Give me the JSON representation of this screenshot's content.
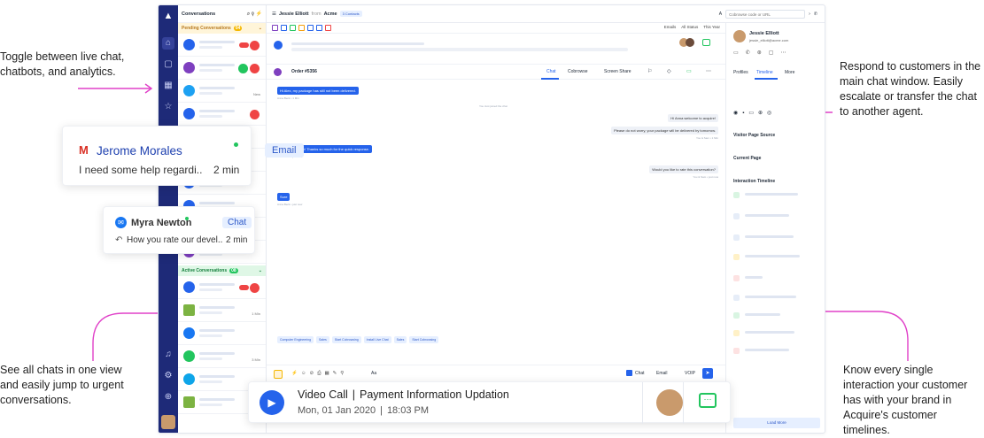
{
  "callouts": {
    "left_top": "Toggle between live chat, chatbots, and analytics.",
    "left_bottom": "See all chats in one view and easily jump to urgent conversations.",
    "right_top": "Respond to customers in the main chat window. Easily escalate or transfer the chat to another agent.",
    "right_bottom": "Know every single interaction your customer has with your brand in Acquire's customer timelines."
  },
  "sidebar": {
    "title": "Conversations",
    "pending_label": "Pending Conversations",
    "pending_count": "04",
    "active_label": "Active Conversations",
    "active_count": "08",
    "timestamps": {
      "new": "New",
      "min1": "1 Min",
      "min3": "3 Min",
      "min2": "2 Min",
      "min2b": "2 min"
    }
  },
  "header": {
    "user": "Jessie Elliott",
    "from": "from",
    "company": "Acme",
    "contacts": "3 Contacts",
    "cobrowse_placeholder": "Cobrowse code or URL"
  },
  "filters": {
    "emails": "Emails",
    "status": "All Status",
    "period": "This Year"
  },
  "chat": {
    "order": "Order #5356",
    "tabs": {
      "chat": "Chat",
      "cobrowse": "Cobrowse",
      "screen": "Screen Share"
    },
    "messages": {
      "m1": "Hi Alex, my package has still not been delivered.",
      "m1_meta": "Anna Beck  •  1 Min",
      "joined": "You Just joined the chat",
      "m2": "Hi Anna welcome to acquire!",
      "m3": "Please do not worry, your package will be delivered by tomorrow.",
      "m3_meta": "You & Sam  •  1 Min",
      "m4": "Wow, awesome! Thanks so much for the quick response.",
      "m4_meta": "Anna Beck  •  just now",
      "m5": "Would you like to rate this conversation?",
      "m5_meta": "You & Sam  •  just now",
      "m6": "Sure",
      "m6_meta": "Anna Beck  •  just now"
    },
    "tags": [
      "Computer Engineering",
      "Sales",
      "Start Cobrowsing",
      "Install Live Chat",
      "Sales",
      "Start Cobrowsing"
    ],
    "compose": {
      "chat": "Chat",
      "email": "Email",
      "voip": "VOIP",
      "aa": "Aa"
    }
  },
  "profile": {
    "name": "Jessie Elliott",
    "email": "jessie_elliott@acme.com",
    "tabs": {
      "profiles": "Profiles",
      "timeline": "Timeline",
      "more": "More"
    },
    "visitor_source": "Visitor Page Source",
    "current_page": "Current Page",
    "interaction_timeline": "Interaction Timeline",
    "load_more": "Load More"
  },
  "cards": {
    "jerome": {
      "name": "Jerome Morales",
      "channel": "Email",
      "preview": "I need some help regardi...",
      "time": "2 min"
    },
    "myra": {
      "name": "Myra Newton",
      "channel": "Chat",
      "preview": "How you rate our devel...",
      "time": "2 min"
    },
    "video": {
      "title": "Video Call",
      "sep": "|",
      "subject": "Payment Information Updation",
      "date": "Mon, 01 Jan 2020",
      "time": "18:03 PM"
    }
  },
  "colors": {
    "navy": "#1e2a78",
    "blue": "#2563eb",
    "magenta": "#e040c8",
    "red": "#ef4444",
    "green": "#22c55e"
  }
}
